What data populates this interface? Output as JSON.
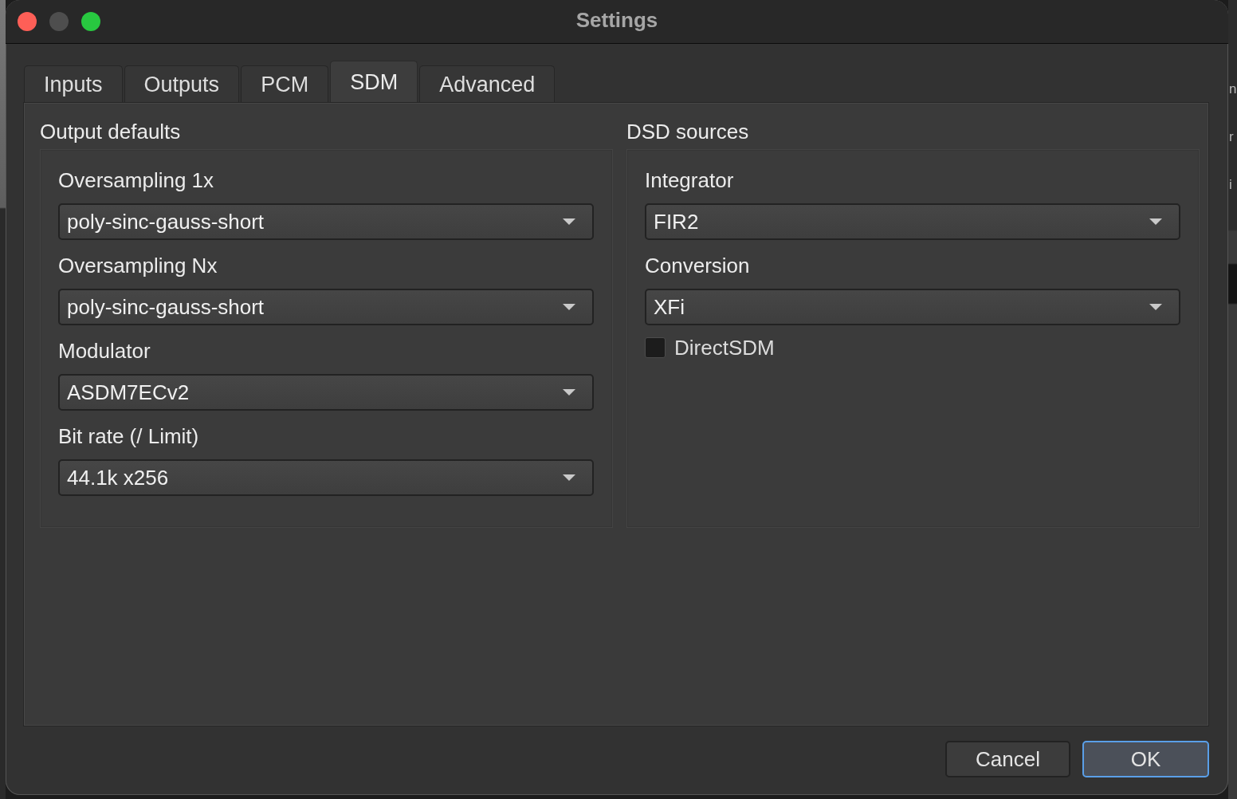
{
  "window": {
    "title": "Settings",
    "controls": [
      {
        "kind": "close",
        "disabled": false
      },
      {
        "kind": "minimize",
        "disabled": true
      },
      {
        "kind": "zoom",
        "disabled": false
      }
    ]
  },
  "tabs": [
    {
      "label": "Inputs",
      "selected": false
    },
    {
      "label": "Outputs",
      "selected": false
    },
    {
      "label": "PCM",
      "selected": false
    },
    {
      "label": "SDM",
      "selected": true
    },
    {
      "label": "Advanced",
      "selected": false
    }
  ],
  "groups": [
    {
      "title": "Output defaults",
      "fields": [
        {
          "kind": "combo",
          "label": "Oversampling 1x",
          "value": "poly-sinc-gauss-short"
        },
        {
          "kind": "combo",
          "label": "Oversampling Nx",
          "value": "poly-sinc-gauss-short"
        },
        {
          "kind": "combo",
          "label": "Modulator",
          "value": "ASDM7ECv2"
        },
        {
          "kind": "combo",
          "label": "Bit rate (/ Limit)",
          "value": "44.1k x256"
        }
      ]
    },
    {
      "title": "DSD sources",
      "fields": [
        {
          "kind": "combo",
          "label": "Integrator",
          "value": "FIR2"
        },
        {
          "kind": "combo",
          "label": "Conversion",
          "value": "XFi"
        },
        {
          "kind": "checkbox",
          "label": "DirectSDM",
          "checked": false
        }
      ]
    }
  ],
  "buttons": [
    {
      "label": "Cancel",
      "default": false
    },
    {
      "label": "OK",
      "default": true
    }
  ],
  "background_window": {
    "text_fragments": [
      "n",
      "r",
      "i"
    ]
  }
}
